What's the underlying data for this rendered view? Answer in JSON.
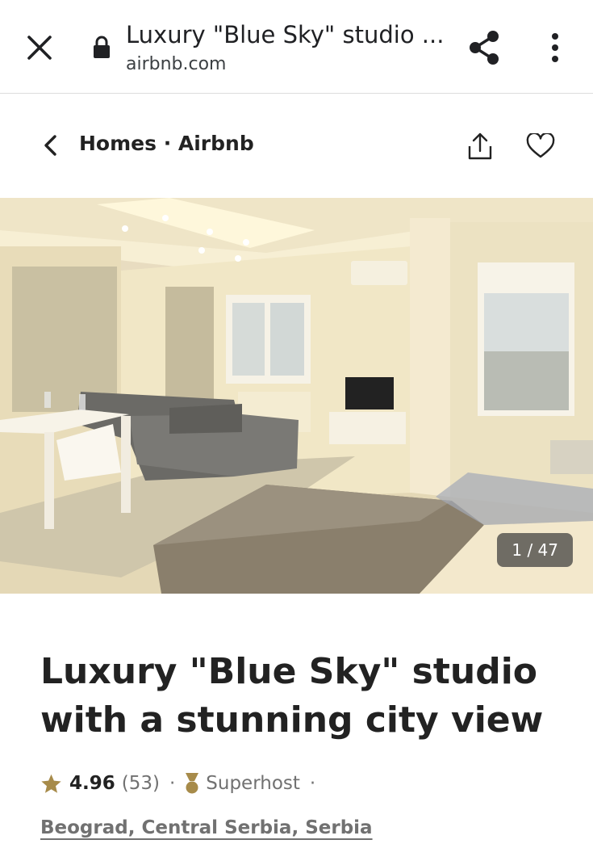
{
  "browser": {
    "title": "Luxury \"Blue Sky\" studio ...",
    "url": "airbnb.com",
    "icons": {
      "close": "close-icon",
      "lock": "lock-icon",
      "share": "share-icon",
      "menu": "more-vert-icon"
    }
  },
  "nav": {
    "breadcrumb": "Homes · Airbnb",
    "icons": {
      "back": "chevron-left-icon",
      "share": "upload-icon",
      "save": "heart-icon"
    }
  },
  "gallery": {
    "counter": "1 / 47",
    "photo": "listing-photo"
  },
  "listing": {
    "title": "Luxury \"Blue Sky\" studio with a stunning city view",
    "rating": "4.96",
    "reviews": "(53)",
    "separator": "·",
    "host_badge": "Superhost",
    "location": "Beograd, Central Serbia, Serbia"
  },
  "colors": {
    "text": "#222222",
    "muted": "#717171",
    "star": "#a78b4a",
    "chrome_text": "#202124"
  }
}
